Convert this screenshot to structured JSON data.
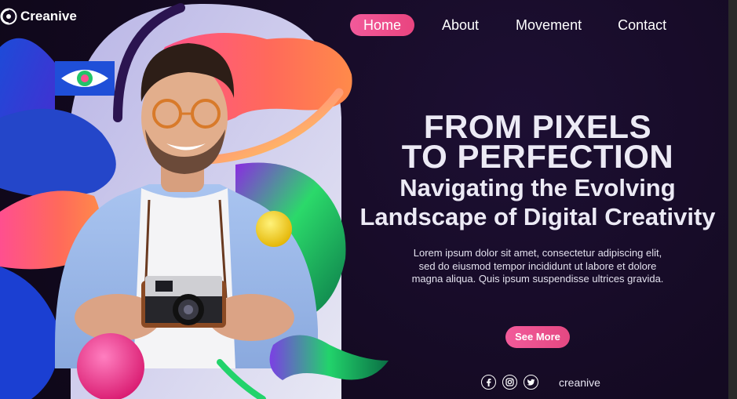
{
  "brand": {
    "name": "Creanive"
  },
  "nav": {
    "items": [
      {
        "label": "Home",
        "active": true
      },
      {
        "label": "About",
        "active": false
      },
      {
        "label": "Movement",
        "active": false
      },
      {
        "label": "Contact",
        "active": false
      }
    ]
  },
  "hero": {
    "title_line1": "FROM PIXELS",
    "title_line2": "TO PERFECTION",
    "subtitle_line1": "Navigating the Evolving",
    "subtitle_line2": "Landscape of Digital Creativity",
    "body_lines": [
      "Lorem ipsum dolor sit amet, consectetur adipiscing elit,",
      "sed do eiusmod tempor incididunt ut labore et dolore",
      "magna aliqua. Quis ipsum suspendisse ultrices gravida."
    ],
    "cta_label": "See More"
  },
  "social": {
    "icons": [
      "facebook-icon",
      "instagram-icon",
      "twitter-icon"
    ],
    "handle": "creanive"
  },
  "colors": {
    "background": "#140a22",
    "accent_pink": "#f25a9a",
    "text": "#eceaf5"
  }
}
